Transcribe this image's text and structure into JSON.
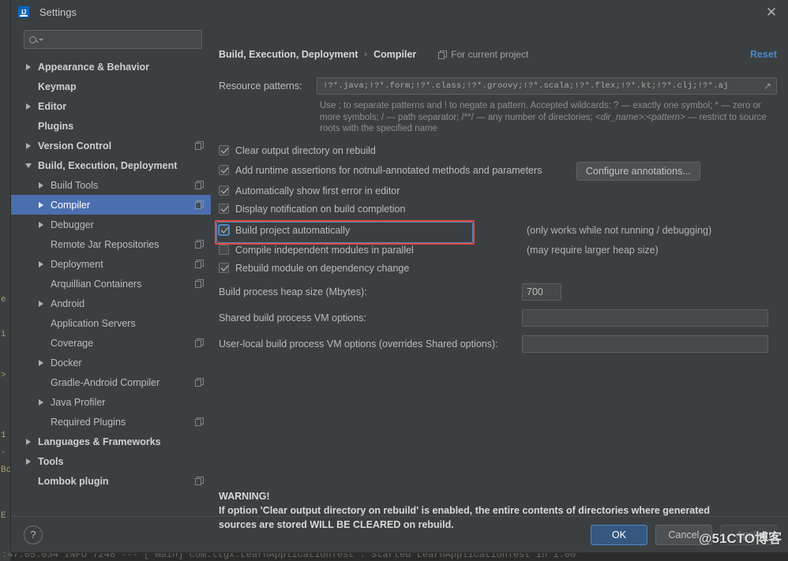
{
  "window": {
    "title": "Settings",
    "logo_icon": "intellij-idea-logo",
    "close_icon": "close-icon"
  },
  "sidebar": {
    "search": {
      "placeholder": "",
      "value": "",
      "icon": "search-icon",
      "dropdown_icon": "chevron-down-icon"
    },
    "items": [
      {
        "label": "Appearance & Behavior",
        "indent": 0,
        "twisty": "right",
        "bold": true,
        "project": false,
        "selected": false
      },
      {
        "label": "Keymap",
        "indent": 0,
        "twisty": "none",
        "bold": true,
        "project": false,
        "selected": false
      },
      {
        "label": "Editor",
        "indent": 0,
        "twisty": "right",
        "bold": true,
        "project": false,
        "selected": false
      },
      {
        "label": "Plugins",
        "indent": 0,
        "twisty": "none",
        "bold": true,
        "project": false,
        "selected": false
      },
      {
        "label": "Version Control",
        "indent": 0,
        "twisty": "right",
        "bold": true,
        "project": true,
        "selected": false
      },
      {
        "label": "Build, Execution, Deployment",
        "indent": 0,
        "twisty": "down",
        "bold": true,
        "project": false,
        "selected": false
      },
      {
        "label": "Build Tools",
        "indent": 1,
        "twisty": "right",
        "bold": false,
        "project": true,
        "selected": false
      },
      {
        "label": "Compiler",
        "indent": 1,
        "twisty": "right",
        "bold": false,
        "project": true,
        "selected": true
      },
      {
        "label": "Debugger",
        "indent": 1,
        "twisty": "right",
        "bold": false,
        "project": false,
        "selected": false
      },
      {
        "label": "Remote Jar Repositories",
        "indent": 1,
        "twisty": "none",
        "bold": false,
        "project": true,
        "selected": false
      },
      {
        "label": "Deployment",
        "indent": 1,
        "twisty": "right",
        "bold": false,
        "project": true,
        "selected": false
      },
      {
        "label": "Arquillian Containers",
        "indent": 1,
        "twisty": "none",
        "bold": false,
        "project": true,
        "selected": false
      },
      {
        "label": "Android",
        "indent": 1,
        "twisty": "right",
        "bold": false,
        "project": false,
        "selected": false
      },
      {
        "label": "Application Servers",
        "indent": 1,
        "twisty": "none",
        "bold": false,
        "project": false,
        "selected": false
      },
      {
        "label": "Coverage",
        "indent": 1,
        "twisty": "none",
        "bold": false,
        "project": true,
        "selected": false
      },
      {
        "label": "Docker",
        "indent": 1,
        "twisty": "right",
        "bold": false,
        "project": false,
        "selected": false
      },
      {
        "label": "Gradle-Android Compiler",
        "indent": 1,
        "twisty": "none",
        "bold": false,
        "project": true,
        "selected": false
      },
      {
        "label": "Java Profiler",
        "indent": 1,
        "twisty": "right",
        "bold": false,
        "project": false,
        "selected": false
      },
      {
        "label": "Required Plugins",
        "indent": 1,
        "twisty": "none",
        "bold": false,
        "project": true,
        "selected": false
      },
      {
        "label": "Languages & Frameworks",
        "indent": 0,
        "twisty": "right",
        "bold": true,
        "project": false,
        "selected": false
      },
      {
        "label": "Tools",
        "indent": 0,
        "twisty": "right",
        "bold": true,
        "project": false,
        "selected": false
      },
      {
        "label": "Lombok plugin",
        "indent": 0,
        "twisty": "none",
        "bold": true,
        "project": true,
        "selected": false
      }
    ]
  },
  "content": {
    "breadcrumb_root": "Build, Execution, Deployment",
    "breadcrumb_sep": "›",
    "breadcrumb_leaf": "Compiler",
    "for_current_project": "For current project",
    "for_current_project_icon": "project-scope-icon",
    "reset_label": "Reset",
    "resource_patterns_label": "Resource patterns:",
    "resource_patterns_value": "!?*.java;!?*.form;!?*.class;!?*.groovy;!?*.scala;!?*.flex;!?*.kt;!?*.clj;!?*.aj",
    "resource_patterns_expand_icon": "expand-editor-icon",
    "resource_patterns_help_1": "Use ; to separate patterns and ! to negate a pattern. Accepted wildcards: ? — exactly one symbol; * — zero or more symbols; / — path separator; /**/ — any number of directories; ",
    "resource_patterns_help_italic": "<dir_name>:<pattern>",
    "resource_patterns_help_2": " — restrict to source roots with the specified name",
    "checkboxes": [
      {
        "label": "Clear output directory on rebuild",
        "checked": true,
        "focused": false,
        "highlighted": false
      },
      {
        "label": "Add runtime assertions for notnull-annotated methods and parameters",
        "checked": true,
        "focused": false,
        "highlighted": false
      },
      {
        "label": "Automatically show first error in editor",
        "checked": true,
        "focused": false,
        "highlighted": false
      },
      {
        "label": "Display notification on build completion",
        "checked": true,
        "focused": false,
        "highlighted": false
      },
      {
        "label": "Build project automatically",
        "checked": true,
        "focused": true,
        "highlighted": true
      },
      {
        "label": "Compile independent modules in parallel",
        "checked": false,
        "focused": false,
        "highlighted": false
      },
      {
        "label": "Rebuild module on dependency change",
        "checked": true,
        "focused": false,
        "highlighted": false
      }
    ],
    "configure_annotations_label": "Configure annotations...",
    "note_build_auto": "(only works while not running / debugging)",
    "note_parallel": "(may require larger heap size)",
    "heap_label": "Build process heap size (Mbytes):",
    "heap_value": "700",
    "shared_vm_label": "Shared build process VM options:",
    "shared_vm_value": "",
    "user_vm_label": "User-local build process VM options (overrides Shared options):",
    "user_vm_value": "",
    "warning_title": "WARNING!",
    "warning_line1": "If option 'Clear output directory on rebuild' is enabled, the entire contents of directories where generated",
    "warning_line2": "sources are stored WILL BE CLEARED on rebuild."
  },
  "footer": {
    "help_label": "?",
    "ok_label": "OK",
    "cancel_label": "Cancel",
    "apply_label": "Apply"
  },
  "watermark": "@51CTO博客",
  "ide_background": {
    "console_line": ":47:05.034  INFO 7248 --- [           main] com.ttgx.LearnApplicationTest            : Started LearnApplicationTest in 1.00",
    "gutter_marks": [
      "e",
      "i",
      ">",
      "1",
      "-",
      "Bc",
      "E"
    ]
  },
  "colors": {
    "accent_blue": "#4a88c7",
    "selection_blue": "#4b6eaf",
    "highlight_red": "#e24b3f",
    "dialog_bg": "#3c3f41",
    "field_bg": "#45494a",
    "text": "#bbbbbb"
  }
}
